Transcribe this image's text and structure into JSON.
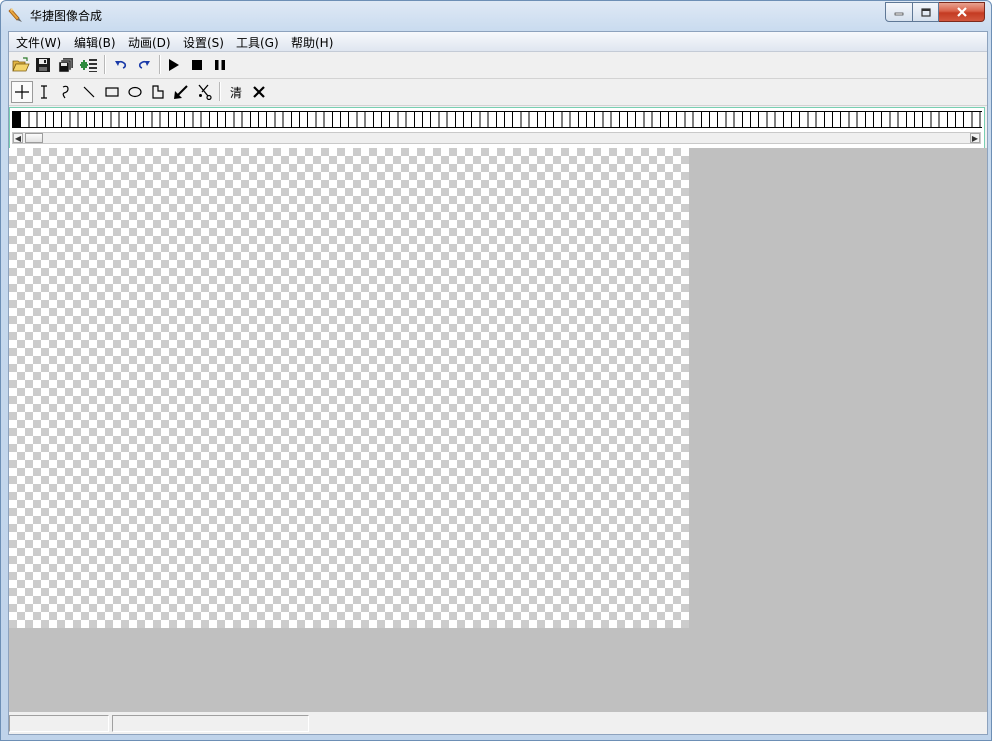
{
  "window": {
    "title": "华捷图像合成"
  },
  "menu": [
    {
      "id": "file",
      "label": "文件(W)"
    },
    {
      "id": "edit",
      "label": "编辑(B)"
    },
    {
      "id": "animation",
      "label": "动画(D)"
    },
    {
      "id": "settings",
      "label": "设置(S)"
    },
    {
      "id": "tools",
      "label": "工具(G)"
    },
    {
      "id": "help",
      "label": "帮助(H)"
    }
  ],
  "toolbar1": [
    {
      "icon": "open-folder-icon"
    },
    {
      "icon": "save-icon"
    },
    {
      "icon": "save-all-icon"
    },
    {
      "icon": "add-frames-icon"
    },
    {
      "icon": "undo-icon"
    },
    {
      "icon": "redo-icon"
    },
    {
      "icon": "play-icon"
    },
    {
      "icon": "stop-icon"
    },
    {
      "icon": "pause-icon"
    }
  ],
  "toolbar2": {
    "tools": [
      {
        "icon": "crosshair-icon",
        "active": true
      },
      {
        "icon": "text-cursor-icon"
      },
      {
        "icon": "freehand-curve-icon"
      },
      {
        "icon": "line-icon"
      },
      {
        "icon": "rectangle-icon"
      },
      {
        "icon": "ellipse-icon"
      },
      {
        "icon": "polygon-icon"
      },
      {
        "icon": "fill-arrow-icon"
      },
      {
        "icon": "scissors-icon"
      }
    ],
    "clear_label": "清",
    "delete_icon": "close-x-icon"
  },
  "frames": {
    "selected_index": 0
  },
  "canvas": {
    "background": "transparent-checkerboard",
    "surround_color": "#c0c0c0"
  },
  "statusbar": {
    "pane1": "",
    "pane2": ""
  }
}
